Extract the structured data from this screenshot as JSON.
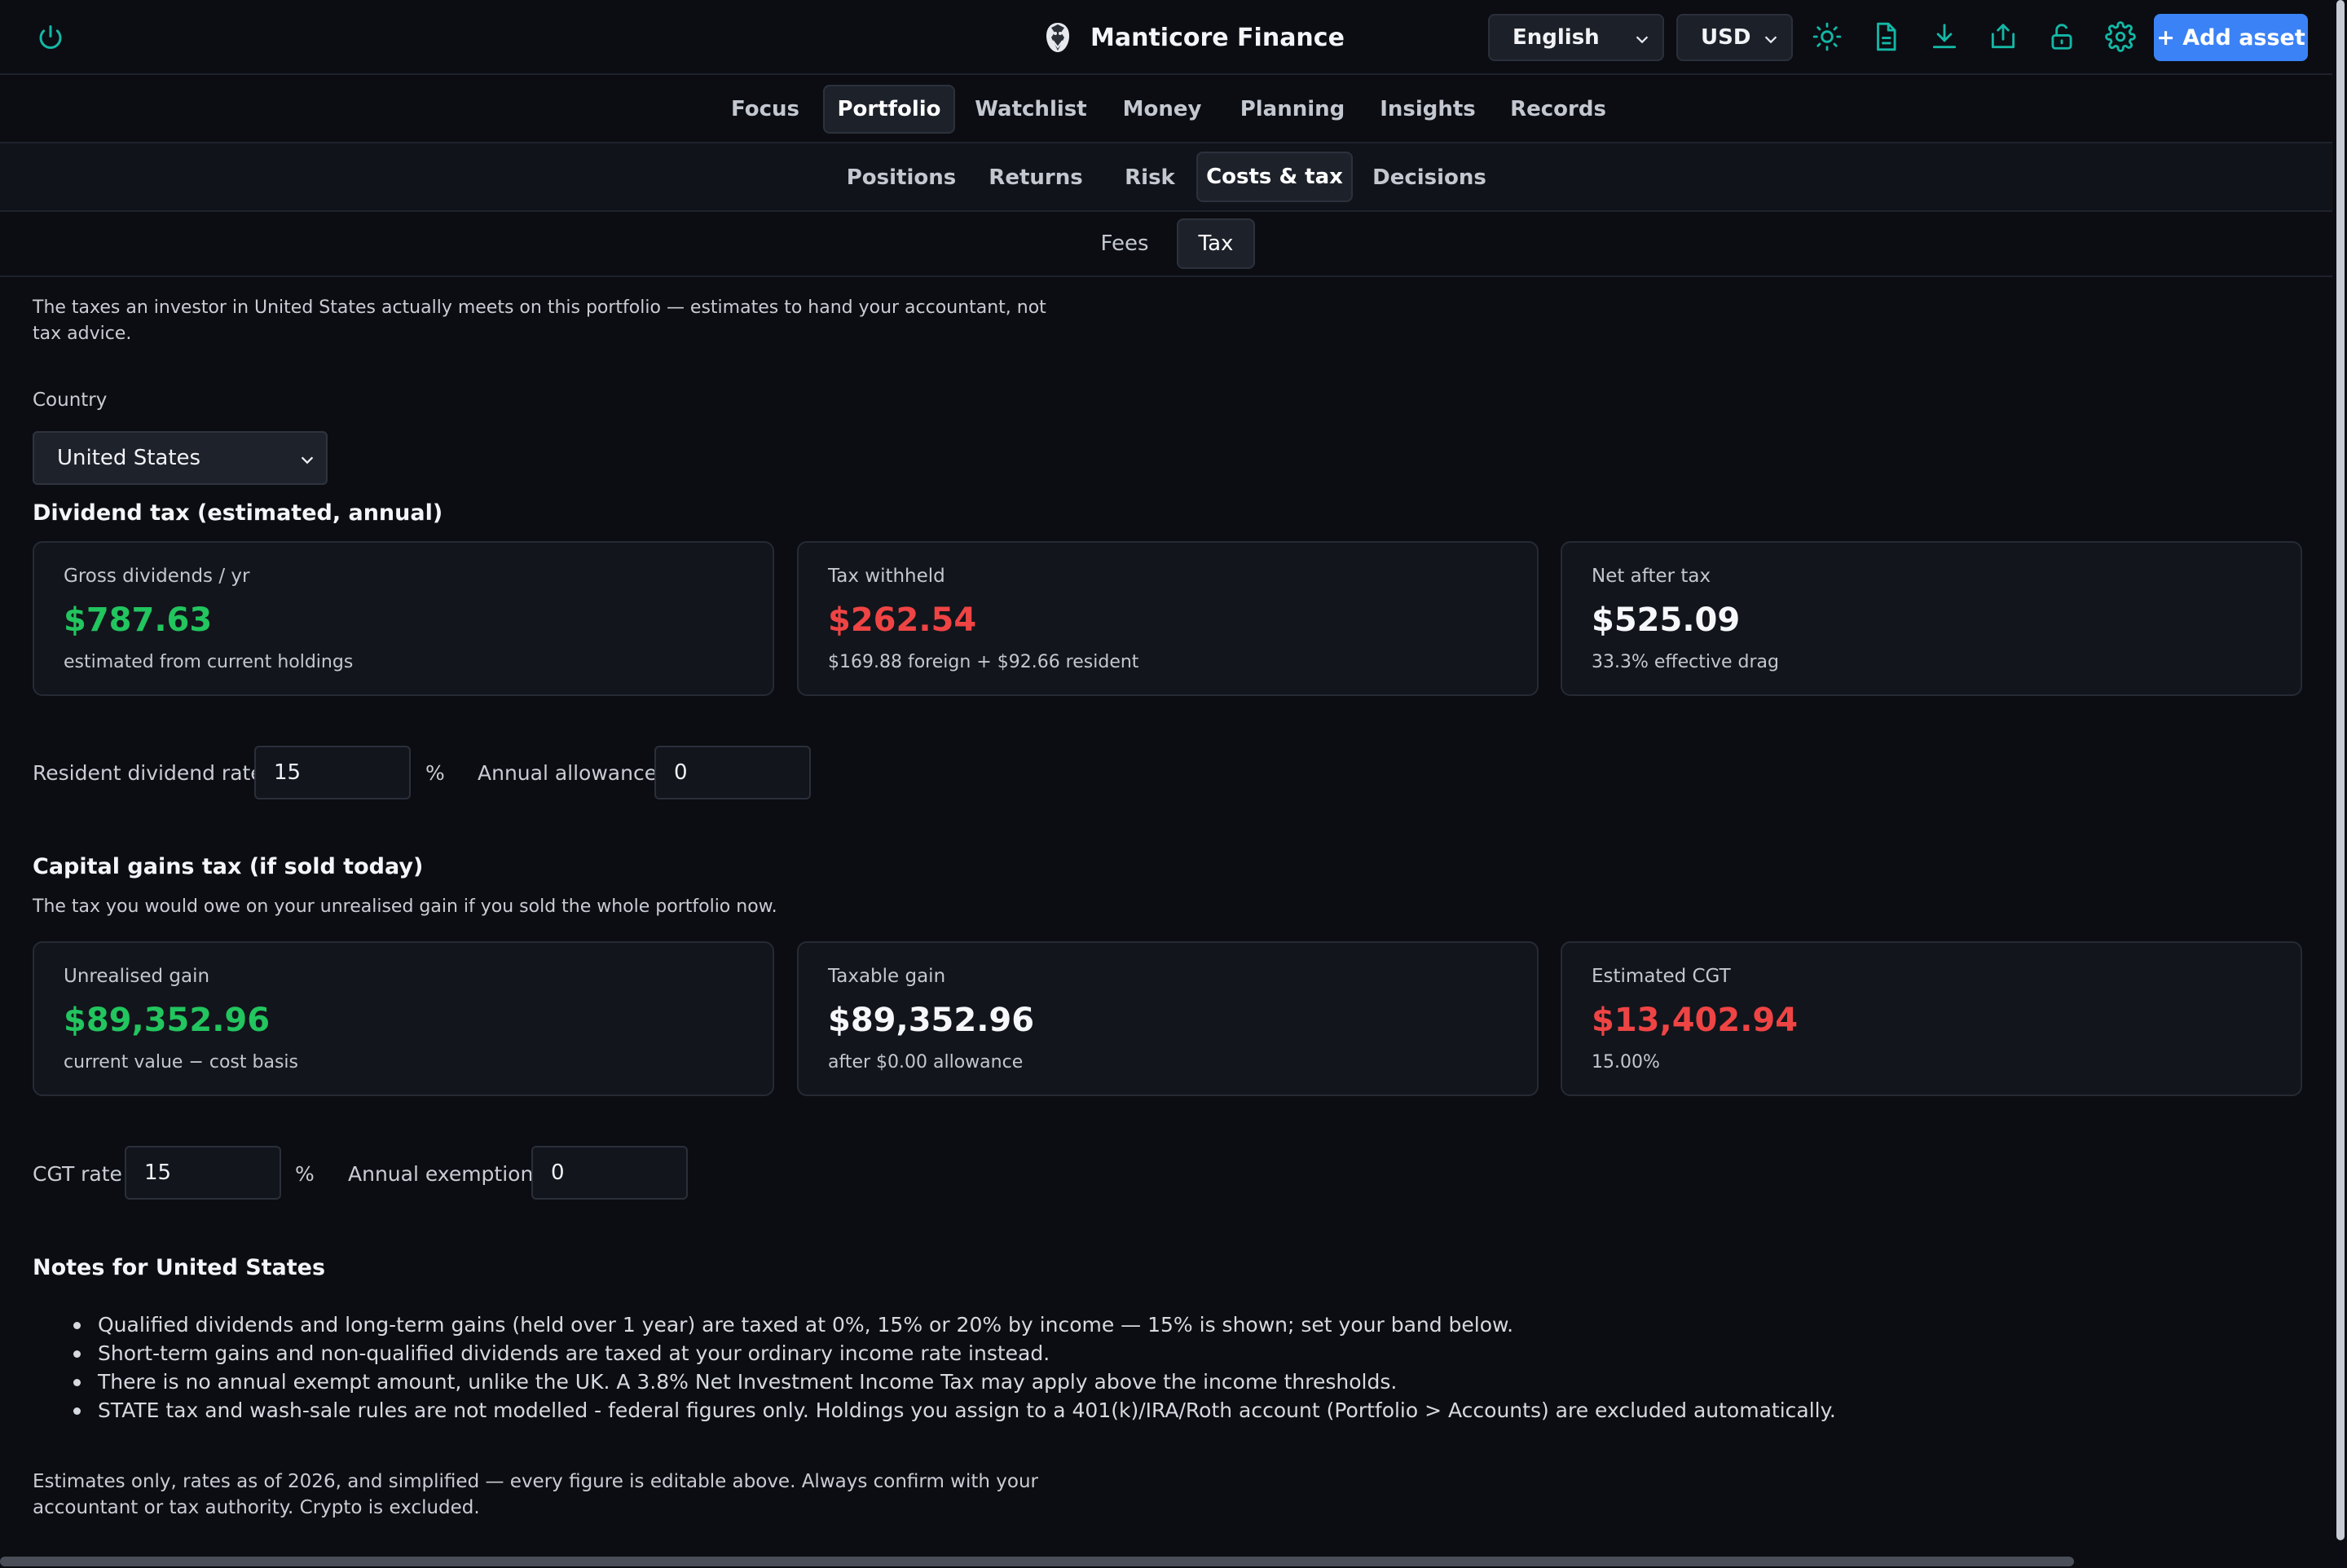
{
  "app": {
    "title": "Manticore Finance"
  },
  "header": {
    "language": "English",
    "currency": "USD",
    "add_asset": "+ Add asset",
    "icons": [
      "power-icon",
      "sun-icon",
      "document-icon",
      "download-icon",
      "share-icon",
      "unlock-icon",
      "gear-icon"
    ]
  },
  "nav": {
    "main": [
      "Focus",
      "Portfolio",
      "Watchlist",
      "Money",
      "Planning",
      "Insights",
      "Records"
    ],
    "main_active": "Portfolio",
    "sub": [
      "Positions",
      "Returns",
      "Risk",
      "Costs & tax",
      "Decisions"
    ],
    "sub_active": "Costs & tax",
    "subsub": [
      "Fees",
      "Tax"
    ],
    "subsub_active": "Tax"
  },
  "intro": "The taxes an investor in United States actually meets on this portfolio — estimates to hand your accountant, not tax advice.",
  "country": {
    "label": "Country",
    "value": "United States"
  },
  "dividend": {
    "title": "Dividend tax (estimated, annual)",
    "cards": [
      {
        "title": "Gross dividends / yr",
        "value": "$787.63",
        "sub": "estimated from current holdings",
        "color": "#22c55e"
      },
      {
        "title": "Tax withheld",
        "value": "$262.54",
        "sub": "$169.88 foreign + $92.66 resident",
        "color": "#ef4444"
      },
      {
        "title": "Net after tax",
        "value": "$525.09",
        "sub": "33.3% effective drag",
        "color": "#f6f7fa"
      }
    ],
    "rate_label": "Resident dividend rate",
    "rate_value": "15",
    "rate_unit": "%",
    "allowance_label": "Annual allowance",
    "allowance_value": "0"
  },
  "cgt": {
    "title": "Capital gains tax (if sold today)",
    "subtitle": "The tax you would owe on your unrealised gain if you sold the whole portfolio now.",
    "cards": [
      {
        "title": "Unrealised gain",
        "value": "$89,352.96",
        "sub": "current value − cost basis",
        "color": "#22c55e"
      },
      {
        "title": "Taxable gain",
        "value": "$89,352.96",
        "sub": "after $0.00 allowance",
        "color": "#f6f7fa"
      },
      {
        "title": "Estimated CGT",
        "value": "$13,402.94",
        "sub": "15.00%",
        "color": "#ef4444"
      }
    ],
    "rate_label": "CGT rate",
    "rate_value": "15",
    "rate_unit": "%",
    "exemption_label": "Annual exemption",
    "exemption_value": "0"
  },
  "notes": {
    "title": "Notes for United States",
    "items": [
      "Qualified dividends and long-term gains (held over 1 year) are taxed at 0%, 15% or 20% by income — 15% is shown; set your band below.",
      "Short-term gains and non-qualified dividends are taxed at your ordinary income rate instead.",
      "There is no annual exempt amount, unlike the UK. A 3.8% Net Investment Income Tax may apply above the income thresholds.",
      "STATE tax and wash-sale rules are not modelled - federal figures only. Holdings you assign to a 401(k)/IRA/Roth account (Portfolio > Accounts) are excluded automatically."
    ]
  },
  "footer": "Estimates only, rates as of 2026, and simplified — every figure is editable above. Always confirm with your accountant or tax authority. Crypto is excluded.",
  "colors": {
    "accent": "#3b82f6",
    "icon_teal": "#14b8a6",
    "positive": "#22c55e",
    "negative": "#ef4444",
    "background": "#0b0d12"
  }
}
